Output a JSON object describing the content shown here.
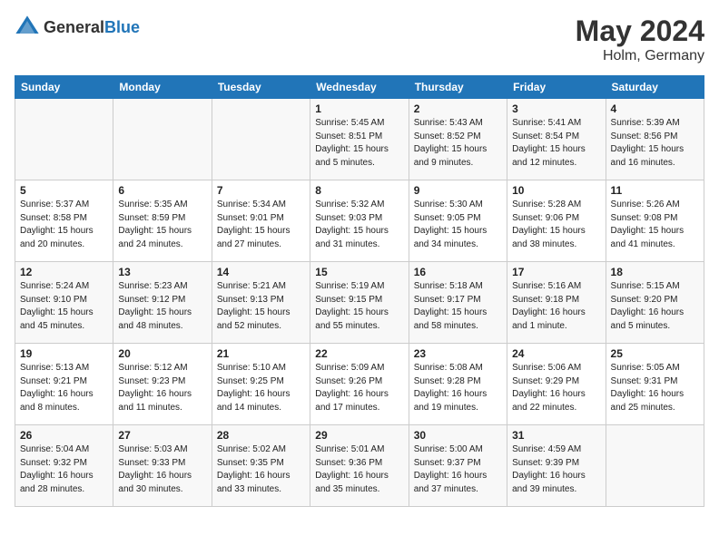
{
  "header": {
    "logo_general": "General",
    "logo_blue": "Blue",
    "title": "May 2024",
    "location": "Holm, Germany"
  },
  "weekdays": [
    "Sunday",
    "Monday",
    "Tuesday",
    "Wednesday",
    "Thursday",
    "Friday",
    "Saturday"
  ],
  "weeks": [
    [
      {
        "day": "",
        "sunrise": "",
        "sunset": "",
        "daylight": ""
      },
      {
        "day": "",
        "sunrise": "",
        "sunset": "",
        "daylight": ""
      },
      {
        "day": "",
        "sunrise": "",
        "sunset": "",
        "daylight": ""
      },
      {
        "day": "1",
        "sunrise": "Sunrise: 5:45 AM",
        "sunset": "Sunset: 8:51 PM",
        "daylight": "Daylight: 15 hours and 5 minutes."
      },
      {
        "day": "2",
        "sunrise": "Sunrise: 5:43 AM",
        "sunset": "Sunset: 8:52 PM",
        "daylight": "Daylight: 15 hours and 9 minutes."
      },
      {
        "day": "3",
        "sunrise": "Sunrise: 5:41 AM",
        "sunset": "Sunset: 8:54 PM",
        "daylight": "Daylight: 15 hours and 12 minutes."
      },
      {
        "day": "4",
        "sunrise": "Sunrise: 5:39 AM",
        "sunset": "Sunset: 8:56 PM",
        "daylight": "Daylight: 15 hours and 16 minutes."
      }
    ],
    [
      {
        "day": "5",
        "sunrise": "Sunrise: 5:37 AM",
        "sunset": "Sunset: 8:58 PM",
        "daylight": "Daylight: 15 hours and 20 minutes."
      },
      {
        "day": "6",
        "sunrise": "Sunrise: 5:35 AM",
        "sunset": "Sunset: 8:59 PM",
        "daylight": "Daylight: 15 hours and 24 minutes."
      },
      {
        "day": "7",
        "sunrise": "Sunrise: 5:34 AM",
        "sunset": "Sunset: 9:01 PM",
        "daylight": "Daylight: 15 hours and 27 minutes."
      },
      {
        "day": "8",
        "sunrise": "Sunrise: 5:32 AM",
        "sunset": "Sunset: 9:03 PM",
        "daylight": "Daylight: 15 hours and 31 minutes."
      },
      {
        "day": "9",
        "sunrise": "Sunrise: 5:30 AM",
        "sunset": "Sunset: 9:05 PM",
        "daylight": "Daylight: 15 hours and 34 minutes."
      },
      {
        "day": "10",
        "sunrise": "Sunrise: 5:28 AM",
        "sunset": "Sunset: 9:06 PM",
        "daylight": "Daylight: 15 hours and 38 minutes."
      },
      {
        "day": "11",
        "sunrise": "Sunrise: 5:26 AM",
        "sunset": "Sunset: 9:08 PM",
        "daylight": "Daylight: 15 hours and 41 minutes."
      }
    ],
    [
      {
        "day": "12",
        "sunrise": "Sunrise: 5:24 AM",
        "sunset": "Sunset: 9:10 PM",
        "daylight": "Daylight: 15 hours and 45 minutes."
      },
      {
        "day": "13",
        "sunrise": "Sunrise: 5:23 AM",
        "sunset": "Sunset: 9:12 PM",
        "daylight": "Daylight: 15 hours and 48 minutes."
      },
      {
        "day": "14",
        "sunrise": "Sunrise: 5:21 AM",
        "sunset": "Sunset: 9:13 PM",
        "daylight": "Daylight: 15 hours and 52 minutes."
      },
      {
        "day": "15",
        "sunrise": "Sunrise: 5:19 AM",
        "sunset": "Sunset: 9:15 PM",
        "daylight": "Daylight: 15 hours and 55 minutes."
      },
      {
        "day": "16",
        "sunrise": "Sunrise: 5:18 AM",
        "sunset": "Sunset: 9:17 PM",
        "daylight": "Daylight: 15 hours and 58 minutes."
      },
      {
        "day": "17",
        "sunrise": "Sunrise: 5:16 AM",
        "sunset": "Sunset: 9:18 PM",
        "daylight": "Daylight: 16 hours and 1 minute."
      },
      {
        "day": "18",
        "sunrise": "Sunrise: 5:15 AM",
        "sunset": "Sunset: 9:20 PM",
        "daylight": "Daylight: 16 hours and 5 minutes."
      }
    ],
    [
      {
        "day": "19",
        "sunrise": "Sunrise: 5:13 AM",
        "sunset": "Sunset: 9:21 PM",
        "daylight": "Daylight: 16 hours and 8 minutes."
      },
      {
        "day": "20",
        "sunrise": "Sunrise: 5:12 AM",
        "sunset": "Sunset: 9:23 PM",
        "daylight": "Daylight: 16 hours and 11 minutes."
      },
      {
        "day": "21",
        "sunrise": "Sunrise: 5:10 AM",
        "sunset": "Sunset: 9:25 PM",
        "daylight": "Daylight: 16 hours and 14 minutes."
      },
      {
        "day": "22",
        "sunrise": "Sunrise: 5:09 AM",
        "sunset": "Sunset: 9:26 PM",
        "daylight": "Daylight: 16 hours and 17 minutes."
      },
      {
        "day": "23",
        "sunrise": "Sunrise: 5:08 AM",
        "sunset": "Sunset: 9:28 PM",
        "daylight": "Daylight: 16 hours and 19 minutes."
      },
      {
        "day": "24",
        "sunrise": "Sunrise: 5:06 AM",
        "sunset": "Sunset: 9:29 PM",
        "daylight": "Daylight: 16 hours and 22 minutes."
      },
      {
        "day": "25",
        "sunrise": "Sunrise: 5:05 AM",
        "sunset": "Sunset: 9:31 PM",
        "daylight": "Daylight: 16 hours and 25 minutes."
      }
    ],
    [
      {
        "day": "26",
        "sunrise": "Sunrise: 5:04 AM",
        "sunset": "Sunset: 9:32 PM",
        "daylight": "Daylight: 16 hours and 28 minutes."
      },
      {
        "day": "27",
        "sunrise": "Sunrise: 5:03 AM",
        "sunset": "Sunset: 9:33 PM",
        "daylight": "Daylight: 16 hours and 30 minutes."
      },
      {
        "day": "28",
        "sunrise": "Sunrise: 5:02 AM",
        "sunset": "Sunset: 9:35 PM",
        "daylight": "Daylight: 16 hours and 33 minutes."
      },
      {
        "day": "29",
        "sunrise": "Sunrise: 5:01 AM",
        "sunset": "Sunset: 9:36 PM",
        "daylight": "Daylight: 16 hours and 35 minutes."
      },
      {
        "day": "30",
        "sunrise": "Sunrise: 5:00 AM",
        "sunset": "Sunset: 9:37 PM",
        "daylight": "Daylight: 16 hours and 37 minutes."
      },
      {
        "day": "31",
        "sunrise": "Sunrise: 4:59 AM",
        "sunset": "Sunset: 9:39 PM",
        "daylight": "Daylight: 16 hours and 39 minutes."
      },
      {
        "day": "",
        "sunrise": "",
        "sunset": "",
        "daylight": ""
      }
    ]
  ]
}
